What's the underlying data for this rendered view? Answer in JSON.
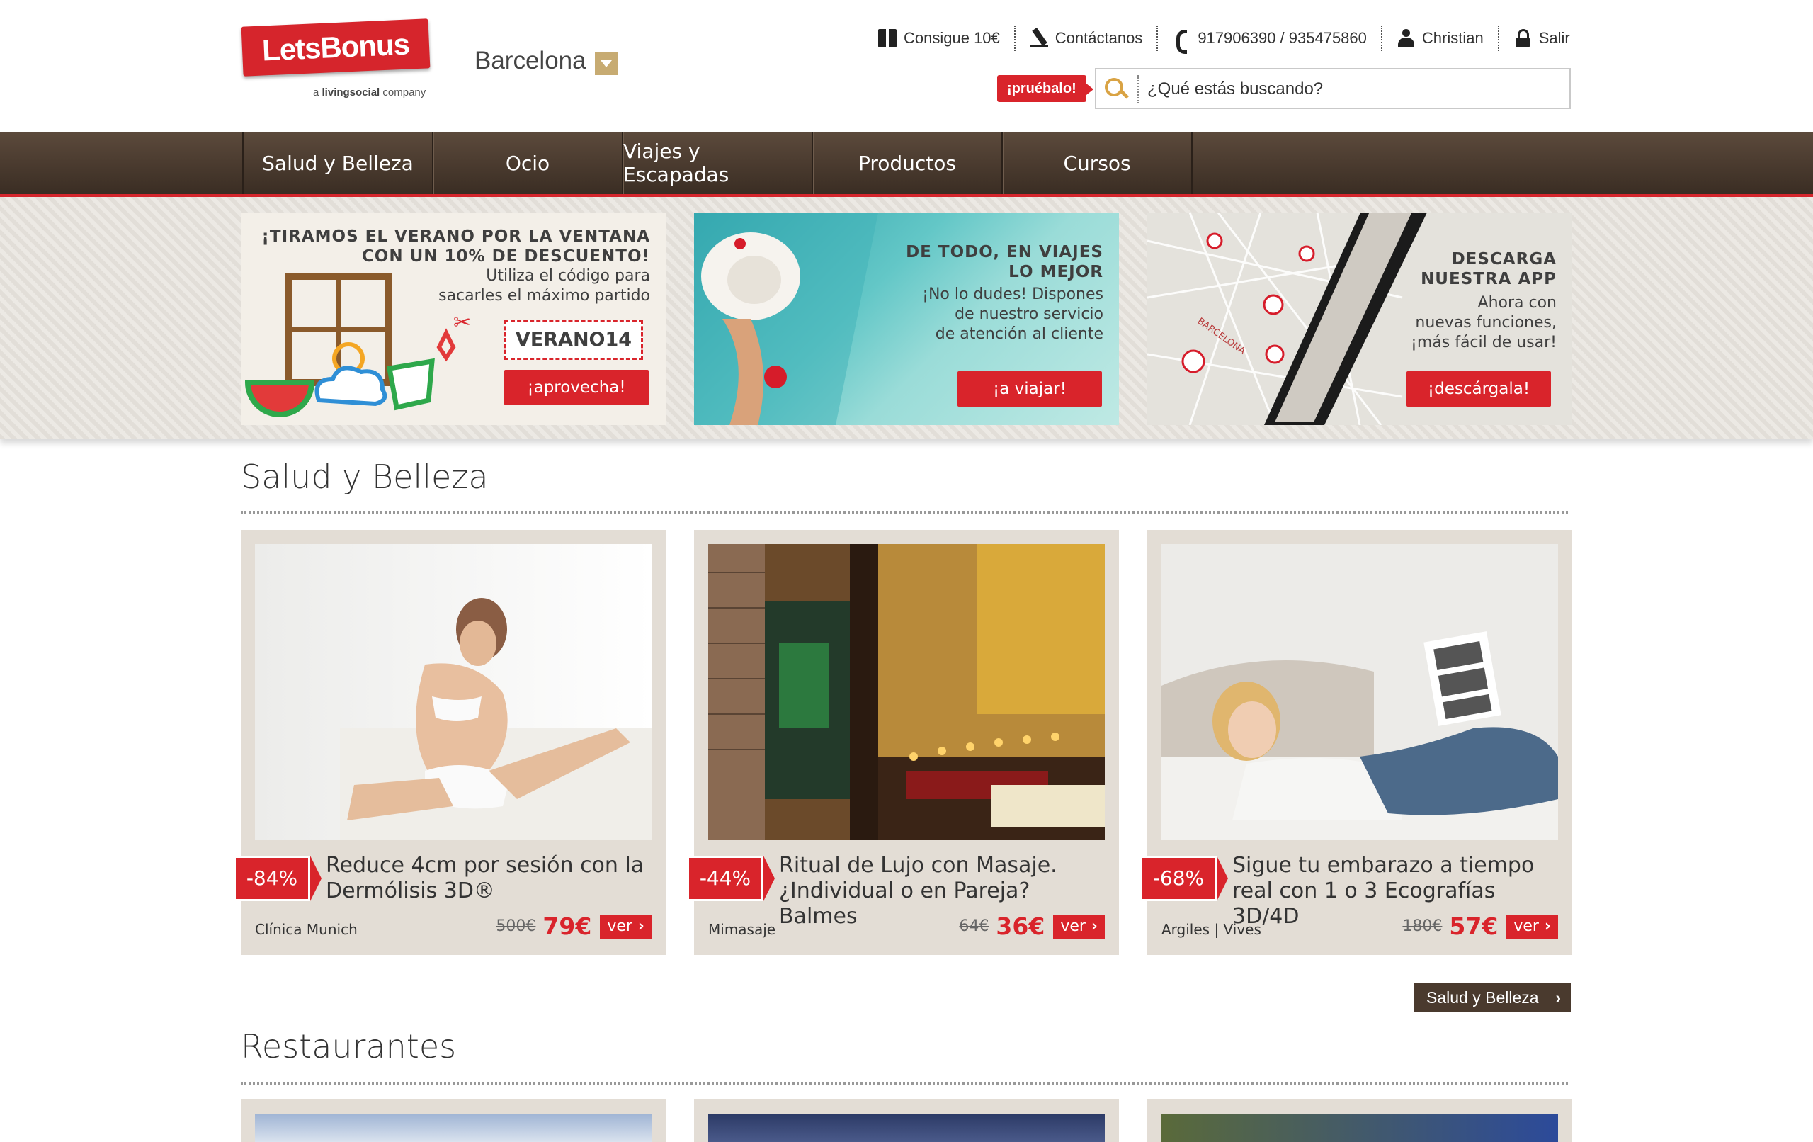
{
  "header": {
    "logo": {
      "brand": "LetsBonus",
      "sub_prefix": "a",
      "sub_brand": "livingsocial",
      "sub_suffix": "company"
    },
    "city": "Barcelona",
    "top_links": [
      {
        "label": "Consigue 10€",
        "icon": "gift-icon"
      },
      {
        "label": "Contáctanos",
        "icon": "pen-icon"
      },
      {
        "label": "917906390 / 935475860",
        "icon": "phone-icon"
      },
      {
        "label": "Christian",
        "icon": "user-icon"
      },
      {
        "label": "Salir",
        "icon": "lock-icon"
      }
    ],
    "try_badge": "¡pruébalo!",
    "search": {
      "placeholder": "¿Qué estás buscando?",
      "value": ""
    }
  },
  "nav": {
    "items": [
      {
        "label": "Salud y Belleza"
      },
      {
        "label": "Ocio"
      },
      {
        "label": "Viajes y Escapadas"
      },
      {
        "label": "Productos"
      },
      {
        "label": "Cursos"
      }
    ]
  },
  "banners": [
    {
      "title_lines": [
        "¡TIRAMOS EL VERANO POR LA VENTANA",
        "CON UN 10% DE DESCUENTO!"
      ],
      "sub_lines": [
        "Utiliza el código para",
        "sacarles el máximo partido"
      ],
      "code": "VERANO14",
      "button": "¡aprovecha!"
    },
    {
      "title_lines": [
        "DE TODO, EN VIAJES",
        "LO MEJOR"
      ],
      "sub_lines": [
        "¡No lo dudes! Dispones",
        "de nuestro servicio",
        "de atención al cliente"
      ],
      "button": "¡a viajar!"
    },
    {
      "title_lines": [
        "DESCARGA",
        "NUESTRA APP"
      ],
      "sub_lines": [
        "Ahora con",
        "nuevas funciones,",
        "¡más fácil de usar!"
      ],
      "button": "¡descárgala!",
      "map_labels": [
        "BARCELONA"
      ]
    }
  ],
  "sections": [
    {
      "title": "Salud y Belleza",
      "more_button": "Salud y Belleza",
      "deals": [
        {
          "discount": "-84%",
          "title": "Reduce 4cm por sesión con la Dermólisis 3D®",
          "merchant": "Clínica Munich",
          "old_price": "500€",
          "price": "79€",
          "button": "ver"
        },
        {
          "discount": "-44%",
          "title": "Ritual de Lujo con Masaje. ¿Individual o en Pareja? Balmes",
          "merchant": "Mimasaje",
          "old_price": "64€",
          "price": "36€",
          "button": "ver"
        },
        {
          "discount": "-68%",
          "title": "Sigue tu embarazo a tiempo real con 1 o 3 Ecografías 3D/4D",
          "merchant": "Argiles | Vives",
          "old_price": "180€",
          "price": "57€",
          "button": "ver"
        }
      ]
    },
    {
      "title": "Restaurantes"
    }
  ],
  "colors": {
    "brand_red": "#d9242b",
    "nav_brown": "#4a3a2e",
    "card_bg": "#e3ddd5",
    "accent_gold": "#c7ab72"
  }
}
